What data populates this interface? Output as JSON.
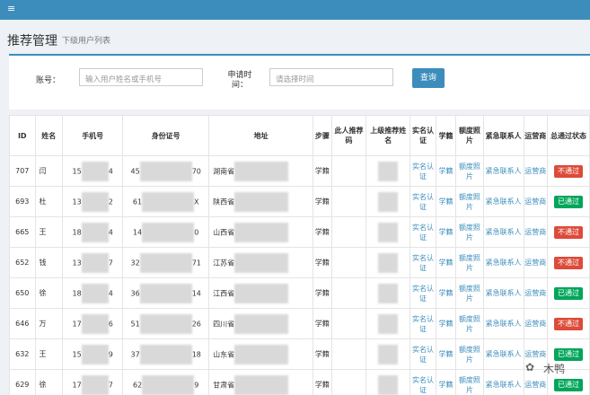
{
  "header": {
    "menu_icon": "hamburger-icon"
  },
  "page": {
    "title": "推荐管理",
    "subtitle": "下级用户列表"
  },
  "search": {
    "account_label": "账号：",
    "account_placeholder": "输入用户姓名或手机号",
    "time_label": "申请时间：",
    "time_placeholder": "请选择时间",
    "query_button": "查询"
  },
  "table": {
    "columns": [
      "ID",
      "姓名",
      "手机号",
      "身份证号",
      "地址",
      "步骤",
      "此人推荐码",
      "上级推荐姓名",
      "实名认证",
      "学籍",
      "额度照片",
      "紧急联系人",
      "运营商",
      "总通过状态"
    ],
    "rows": [
      {
        "id": "707",
        "name": "闫",
        "phone_a": "15",
        "phone_b": "4",
        "idcard_a": "45",
        "idcard_b": "70",
        "addr": "湖南省",
        "step": "学籍",
        "status": "不通过",
        "status_type": "fail"
      },
      {
        "id": "693",
        "name": "杜",
        "phone_a": "13",
        "phone_b": "2",
        "idcard_a": "61",
        "idcard_b": "X",
        "addr": "陕西省",
        "step": "学籍",
        "status": "已通过",
        "status_type": "pass"
      },
      {
        "id": "665",
        "name": "王",
        "phone_a": "18",
        "phone_b": "4",
        "idcard_a": "14",
        "idcard_b": "0",
        "addr": "山西省",
        "step": "学籍",
        "status": "不通过",
        "status_type": "fail"
      },
      {
        "id": "652",
        "name": "钱",
        "phone_a": "13",
        "phone_b": "7",
        "idcard_a": "32",
        "idcard_b": "71",
        "addr": "江苏省",
        "step": "学籍",
        "status": "不通过",
        "status_type": "fail"
      },
      {
        "id": "650",
        "name": "徐",
        "phone_a": "18",
        "phone_b": "4",
        "idcard_a": "36",
        "idcard_b": "14",
        "addr": "江西省",
        "step": "学籍",
        "status": "已通过",
        "status_type": "pass"
      },
      {
        "id": "646",
        "name": "万",
        "phone_a": "17",
        "phone_b": "6",
        "idcard_a": "51",
        "idcard_b": "26",
        "addr": "四川省",
        "step": "学籍",
        "status": "不通过",
        "status_type": "fail"
      },
      {
        "id": "632",
        "name": "王",
        "phone_a": "15",
        "phone_b": "9",
        "idcard_a": "37",
        "idcard_b": "18",
        "addr": "山东省",
        "step": "学籍",
        "status": "已通过",
        "status_type": "pass"
      },
      {
        "id": "629",
        "name": "徐",
        "phone_a": "17",
        "phone_b": "7",
        "idcard_a": "62",
        "idcard_b": "9",
        "addr": "甘肃省",
        "step": "学籍",
        "status": "已通过",
        "status_type": "pass"
      }
    ],
    "link_realname": "实名认证",
    "link_xueji": "学籍",
    "link_quota": "额度照片",
    "link_contact": "紧急联系人",
    "link_operator": "运营商"
  },
  "watermark": {
    "text": "木鸭"
  },
  "colors": {
    "primary": "#3c8dbc",
    "fail": "#dd4b39",
    "pass": "#00a65a"
  }
}
